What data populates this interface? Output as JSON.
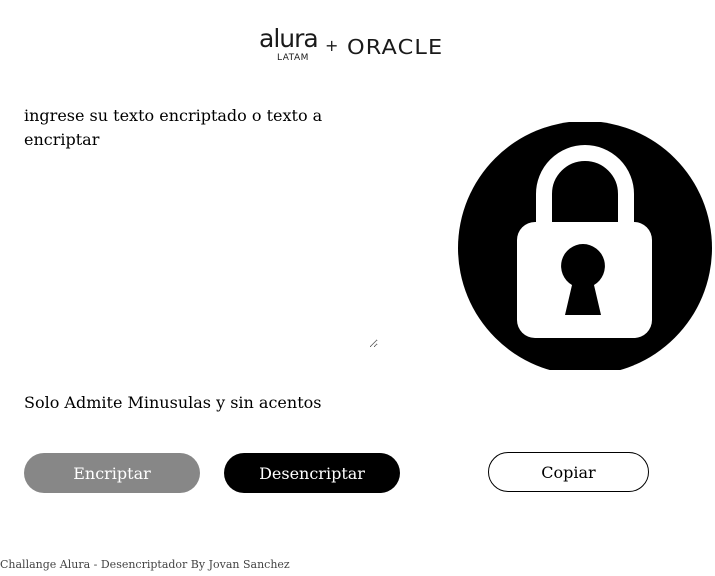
{
  "header": {
    "logo_alura": "alura",
    "logo_latam": "LATAM",
    "logo_plus": "+",
    "logo_oracle": "ORACLE"
  },
  "input": {
    "placeholder": "ingrese su texto encriptado o texto a encriptar",
    "value": ""
  },
  "illustration": {
    "icon": "lock-icon",
    "circle_color": "#000000",
    "lock_color": "#ffffff"
  },
  "note": "Solo Admite Minusulas y sin acentos",
  "buttons": {
    "encrypt_label": "Encriptar",
    "decrypt_label": "Desencriptar",
    "copy_label": "Copiar"
  },
  "colors": {
    "encrypt_bg": "#878787",
    "decrypt_bg": "#000000"
  },
  "footer": "Challange Alura - Desencriptador By Jovan Sanchez"
}
